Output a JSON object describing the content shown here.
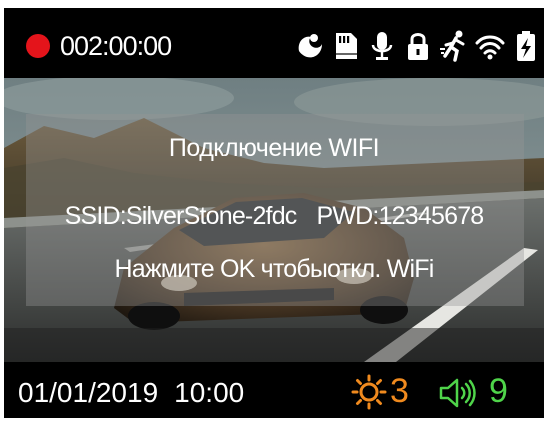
{
  "status_bar": {
    "recording_time": "002:00:00",
    "icons": [
      "parking-mode-icon",
      "sd-card-icon",
      "microphone-icon",
      "lock-icon",
      "motion-detection-icon",
      "wifi-icon",
      "battery-charging-icon"
    ]
  },
  "wifi_dialog": {
    "title": "Подключение WIFI",
    "ssid": "SSID:SilverStone-2fdc",
    "password": "PWD:12345678",
    "hint": "Нажмите OK чтобыоткл. WiFi"
  },
  "bottom_bar": {
    "date": "01/01/2019",
    "time": "10:00",
    "brightness": "3",
    "volume": "9"
  },
  "colors": {
    "record": "#e4141b",
    "brightness": "#f08a1e",
    "volume": "#4fd44a"
  }
}
